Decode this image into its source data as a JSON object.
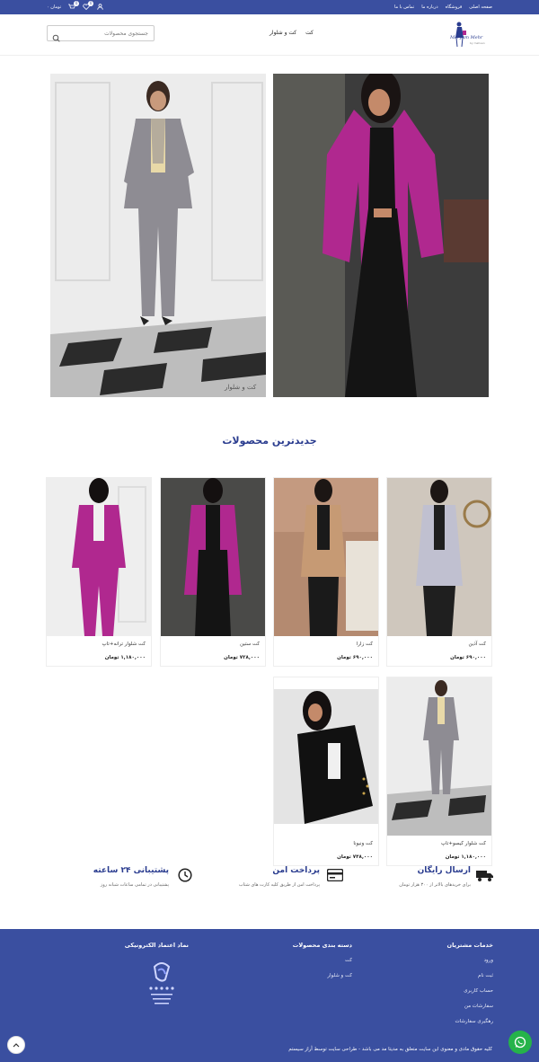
{
  "topbar": {
    "cart_amount": "۰ تومان",
    "cart_count": "0",
    "wishlist_count": "0",
    "nav": [
      "صفحه اصلی",
      "فروشگاه",
      "درباره ما",
      "تماس با ما"
    ]
  },
  "header": {
    "search_placeholder": "جستجوی محصولات",
    "main_nav": [
      "کت",
      "کت و شلوار"
    ],
    "logo_text": "Maryam Mehr",
    "logo_sub": "by mahsan"
  },
  "banner": {
    "left_caption": "کت و شلوار"
  },
  "section": {
    "title": "جدیدترین محصولات"
  },
  "products": [
    {
      "name": "کت آذین",
      "price": "۶۹۰,۰۰۰ تومان"
    },
    {
      "name": "کت زارا",
      "price": "۶۹۰,۰۰۰ تومان"
    },
    {
      "name": "کت ستین",
      "price": "۷۲۸,۰۰۰ تومان"
    },
    {
      "name": "کت شلوار ترانه+تاپ",
      "price": "۱,۱۸۰,۰۰۰ تومان"
    },
    {
      "name": "کت شلوار کیسو+تاپ",
      "price": "۱,۱۸۰,۰۰۰ تومان"
    },
    {
      "name": "کت ونیونا",
      "price": "۷۴۸,۰۰۰ تومان"
    }
  ],
  "features": [
    {
      "title": "ارسال رایگان",
      "desc": "برای خریدهای بالاتر از ۳۰۰ هزار تومان"
    },
    {
      "title": "پرداخت امن",
      "desc": "پرداخت امن از طریق کلیه کارت های شتاب"
    },
    {
      "title": "پشتیبانی ۲۴ ساعته",
      "desc": "پشتیبانی در تمامی ساعات شبانه روز"
    }
  ],
  "footer": {
    "customer_services": {
      "heading": "خدمات مشتریان",
      "links": [
        "ورود",
        "ثبت نام",
        "حساب کاربری",
        "سفارشات من",
        "رهگیری سفارشات"
      ]
    },
    "categories": {
      "heading": "دسته بندی محصولات",
      "links": [
        "کت",
        "کت و شلوار"
      ]
    },
    "trust": {
      "heading": "نماد اعتماد الکترونیکی"
    },
    "copyright": "کلیه حقوق مادی و معنوی این سایت متعلق به مدیتا مد می باشد - طراحی سایت توسط آراز سیستم"
  },
  "colors": {
    "primary": "#3a4fa0",
    "magenta": "#b0288f",
    "whatsapp": "#25b34a"
  }
}
